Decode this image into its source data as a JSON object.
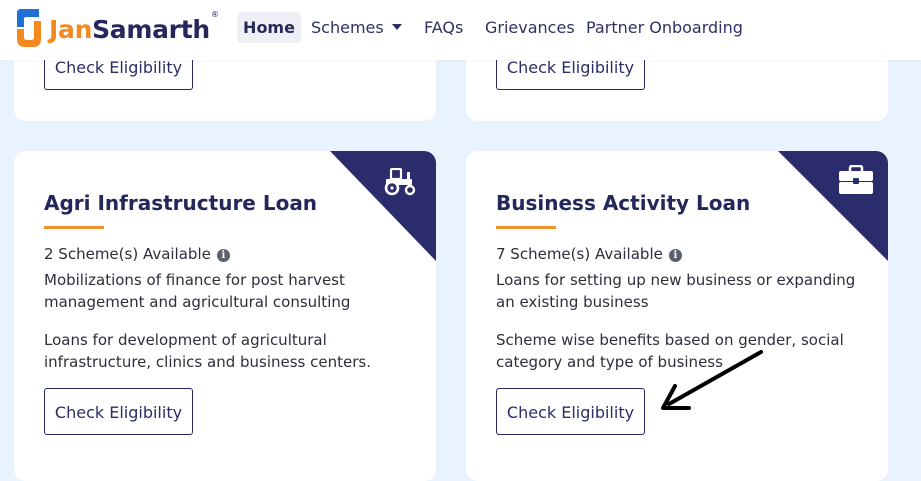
{
  "brand": {
    "part1": "Jan",
    "part2": "Samarth",
    "mark": "®"
  },
  "nav": {
    "home": "Home",
    "schemes": "Schemes",
    "faqs": "FAQs",
    "grievances": "Grievances",
    "partner": "Partner Onboarding"
  },
  "cards": {
    "top_left": {
      "button": "Check Eligibility"
    },
    "top_right": {
      "button": "Check Eligibility"
    },
    "agri": {
      "title": "Agri Infrastructure Loan",
      "available": "2 Scheme(s) Available",
      "desc1": "Mobilizations of finance for post harvest management and agricultural consulting",
      "desc2": "Loans for development of agricultural infrastructure, clinics and business centers.",
      "button": "Check Eligibility",
      "icon": "tractor-icon"
    },
    "business": {
      "title": "Business Activity Loan",
      "available": "7 Scheme(s) Available",
      "desc1": "Loans for setting up new business or expanding an existing business",
      "desc2": "Scheme wise benefits based on gender, social category and type of business",
      "button": "Check Eligibility",
      "icon": "briefcase-icon"
    }
  },
  "colors": {
    "navy": "#2b2c6c",
    "orange": "#f3891f",
    "blue": "#1f6fd6",
    "background": "#e9f3fd"
  }
}
